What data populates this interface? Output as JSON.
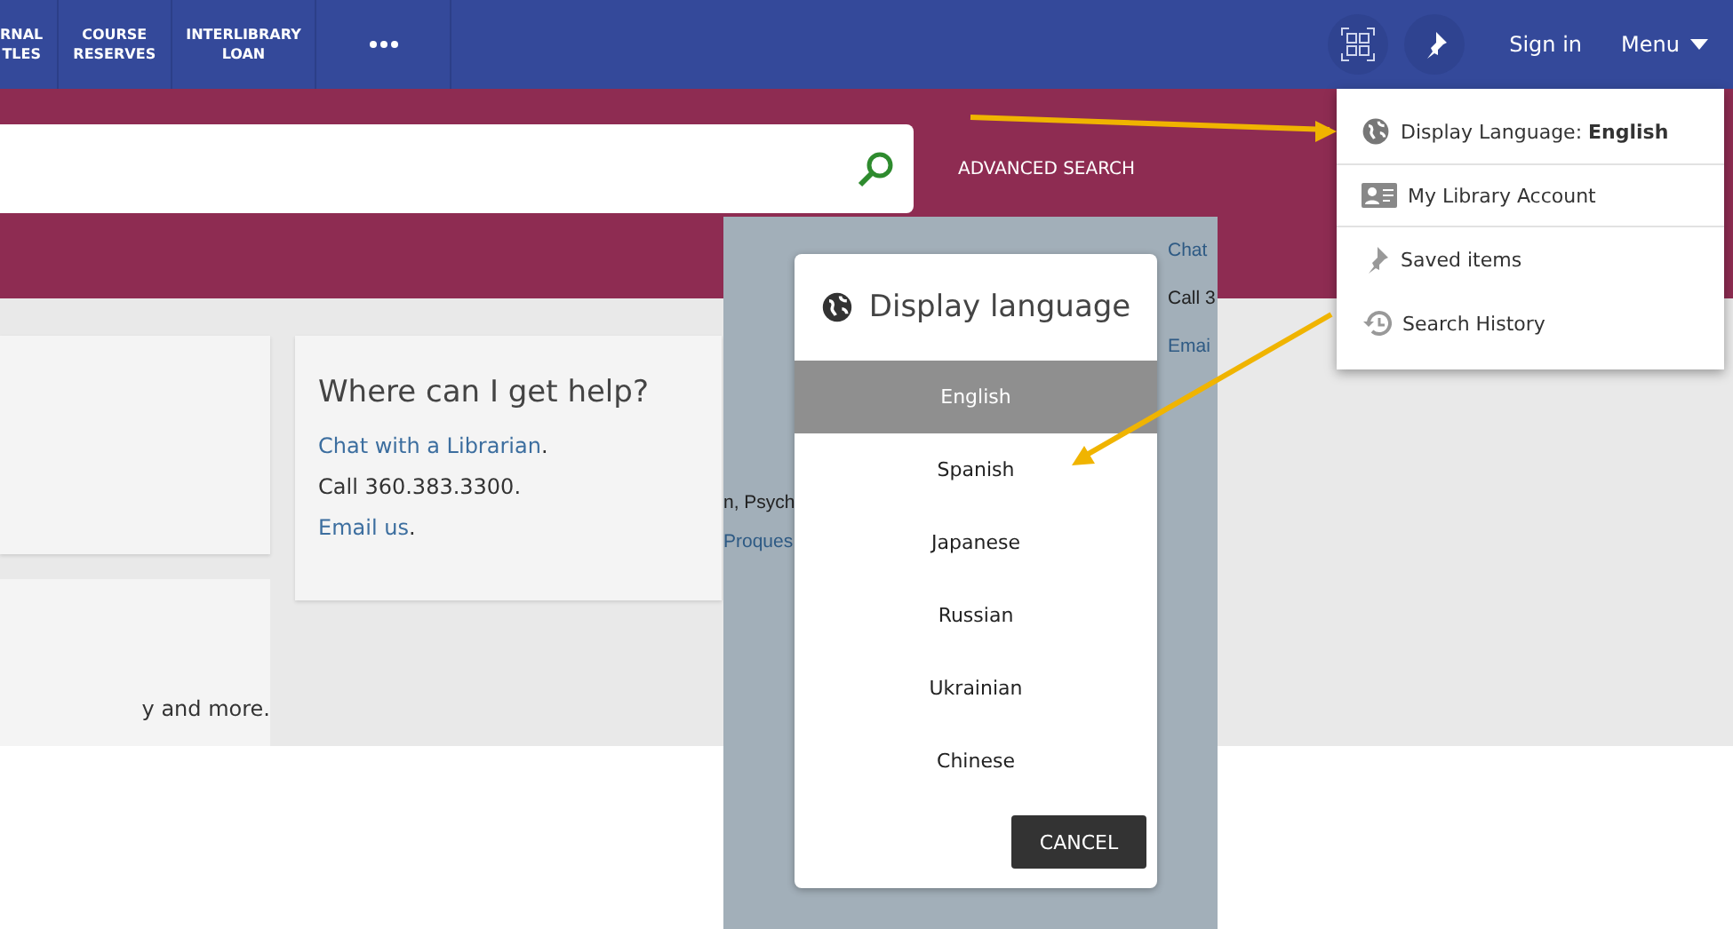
{
  "nav": {
    "items": [
      {
        "label": "RNAL\nTLES"
      },
      {
        "label": "COURSE\nRESERVES"
      },
      {
        "label": "INTERLIBRARY\nLOAN"
      }
    ],
    "sign_in": "Sign in",
    "menu": "Menu"
  },
  "search": {
    "advanced": "ADVANCED SEARCH"
  },
  "cards": {
    "lower_text": "y and more.",
    "help": {
      "title": "Where can I get help?",
      "lines": [
        {
          "kind": "link",
          "text": "Chat with a Librarian",
          "tail": "."
        },
        {
          "kind": "plain",
          "text": "Call 360.383.3300."
        },
        {
          "kind": "link",
          "text": "Email us",
          "tail": "."
        }
      ]
    }
  },
  "backdrop": {
    "right_texts": [
      "Chat",
      "Call 3",
      "Emai"
    ],
    "left_texts": [
      {
        "kind": "plain",
        "text": "n, Psych"
      },
      {
        "kind": "link",
        "text": "Proques"
      }
    ]
  },
  "menu": {
    "items": [
      {
        "kind": "language",
        "text": "Display Language: **English**"
      },
      {
        "kind": "account",
        "text": "My Library Account"
      },
      {
        "kind": "saved",
        "text": "Saved items"
      },
      {
        "kind": "history",
        "text": "Search History"
      }
    ]
  },
  "dialog": {
    "title": "Display language",
    "options": [
      {
        "label": "English",
        "selected": true
      },
      {
        "label": "Spanish",
        "selected": false
      },
      {
        "label": "Japanese",
        "selected": false
      },
      {
        "label": "Russian",
        "selected": false
      },
      {
        "label": "Ukrainian",
        "selected": false
      },
      {
        "label": "Chinese",
        "selected": false
      }
    ],
    "cancel": "CANCEL"
  }
}
